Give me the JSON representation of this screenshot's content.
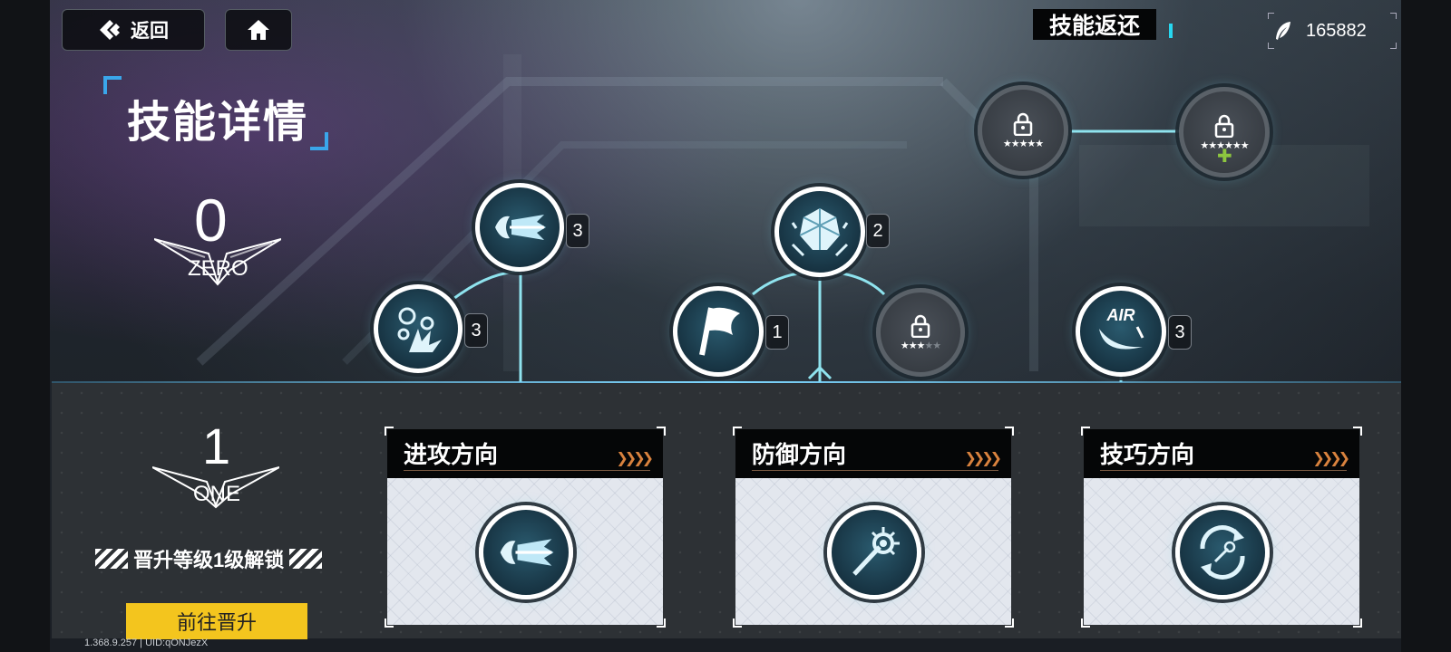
{
  "topbar": {
    "back_label": "返回",
    "skill_return_label": "技能返还",
    "currency_value": "165882"
  },
  "page": {
    "title": "技能详情"
  },
  "tree": {
    "tier_zero": {
      "number": "0",
      "label": "ZERO"
    },
    "nodes": [
      {
        "level": "3"
      },
      {
        "level": "3"
      },
      {
        "level": "2"
      },
      {
        "level": "1"
      },
      {
        "level": "3",
        "text": "AIR"
      }
    ],
    "locked_nodes": [
      {
        "stars_filled": 3,
        "stars_total": 5
      },
      {
        "stars_filled": 5,
        "stars_total": 5
      },
      {
        "stars_filled": 6,
        "stars_total": 6
      }
    ]
  },
  "tier_one": {
    "number": "1",
    "label": "ONE",
    "unlock_text": "晋升等级1级解锁",
    "goto_button": "前往晋升"
  },
  "directions": [
    {
      "title": "进攻方向"
    },
    {
      "title": "防御方向"
    },
    {
      "title": "技巧方向"
    }
  ],
  "version": "1.368.9.257 | UID:qONJezX",
  "colors": {
    "accent": "#7ed7ff",
    "button": "#f3c51e",
    "arrow": "#d9823e"
  }
}
